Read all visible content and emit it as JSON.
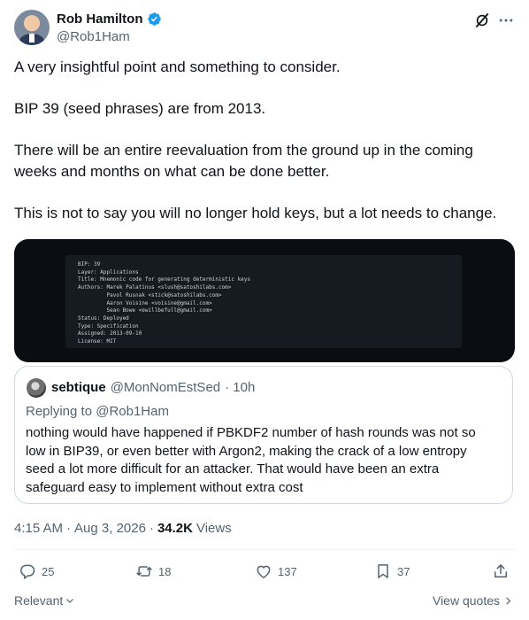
{
  "author": {
    "display_name": "Rob Hamilton",
    "handle": "@Rob1Ham",
    "verified_icon": "verified-badge-icon"
  },
  "header_actions": {
    "grok_icon": "grok-icon",
    "more_icon": "more-options-icon"
  },
  "tweet": {
    "text": "A very insightful point and something to consider.\n\nBIP 39 (seed phrases) are from 2013.\n\nThere will be an entire reevaluation from the ground up in the coming weeks and months on what can be done better.\n\nThis is not to say you will no longer hold keys, but a lot needs to change."
  },
  "media": {
    "lines": [
      "BIP: 39",
      "Layer: Applications",
      "Title: Mnemonic code for generating deterministic keys",
      "Authors: Marek Palatinus <slush@satoshilabs.com>",
      "         Pavol Rusnak <stick@satoshilabs.com>",
      "         Aaron Voisine <voisine@gmail.com>",
      "         Sean Bowe <ewillbefull@gmail.com>",
      "Status: Deployed",
      "Type: Specification",
      "Assigned: 2013-09-10",
      "License: MIT"
    ]
  },
  "quote": {
    "name": "sebtique",
    "handle": "@MonNomEstSed",
    "time": "· 10h",
    "replying_prefix": "Replying to",
    "replying_handle": "@Rob1Ham",
    "text": "nothing would have happened if PBKDF2 number of hash rounds was not so low in BIP39, or even better with Argon2, making the crack of a low entropy seed a lot more difficult for an attacker. That would have been an extra safeguard easy to implement without extra cost"
  },
  "meta": {
    "time": "4:15 AM",
    "dot1": "·",
    "date": "Aug 3, 2026",
    "dot2": "·",
    "views_count": "34.2K",
    "views_label": "Views"
  },
  "actions": {
    "replies": "25",
    "reposts": "18",
    "likes": "137",
    "bookmarks": "37"
  },
  "footer": {
    "sort_label": "Relevant",
    "view_quotes_label": "View quotes"
  },
  "colors": {
    "text": "#0f1419",
    "secondary": "#536471",
    "verified": "#1d9bf0",
    "border": "#cfd9de"
  }
}
